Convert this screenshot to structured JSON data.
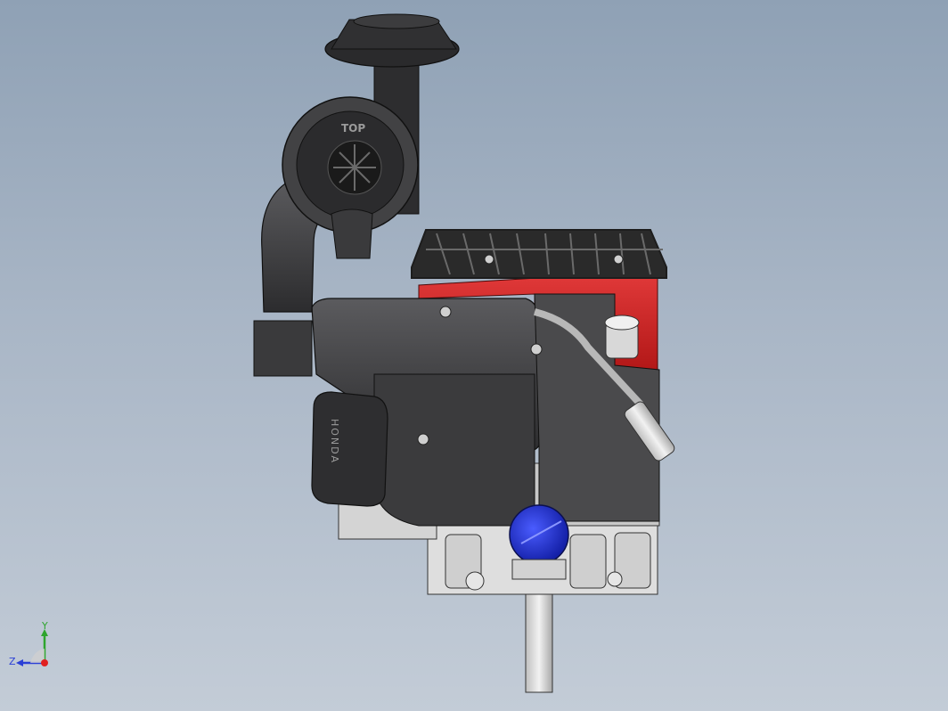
{
  "viewport": {
    "background_top": "#8fa1b5",
    "background_bottom": "#c3ccd7"
  },
  "model": {
    "air_cleaner_cover_label": "TOP",
    "muffler_label": "HONDA",
    "colors": {
      "shroud": "#d11f1f",
      "housing": "#3c3c3e",
      "oil_filter": "#1f2fd0",
      "crankcase": "#d9d9d9"
    }
  },
  "triad": {
    "x_label": "",
    "y_label": "Y",
    "z_label": "Z",
    "x_color": "#e02020",
    "y_color": "#2ea52e",
    "z_color": "#2a3fd6"
  }
}
